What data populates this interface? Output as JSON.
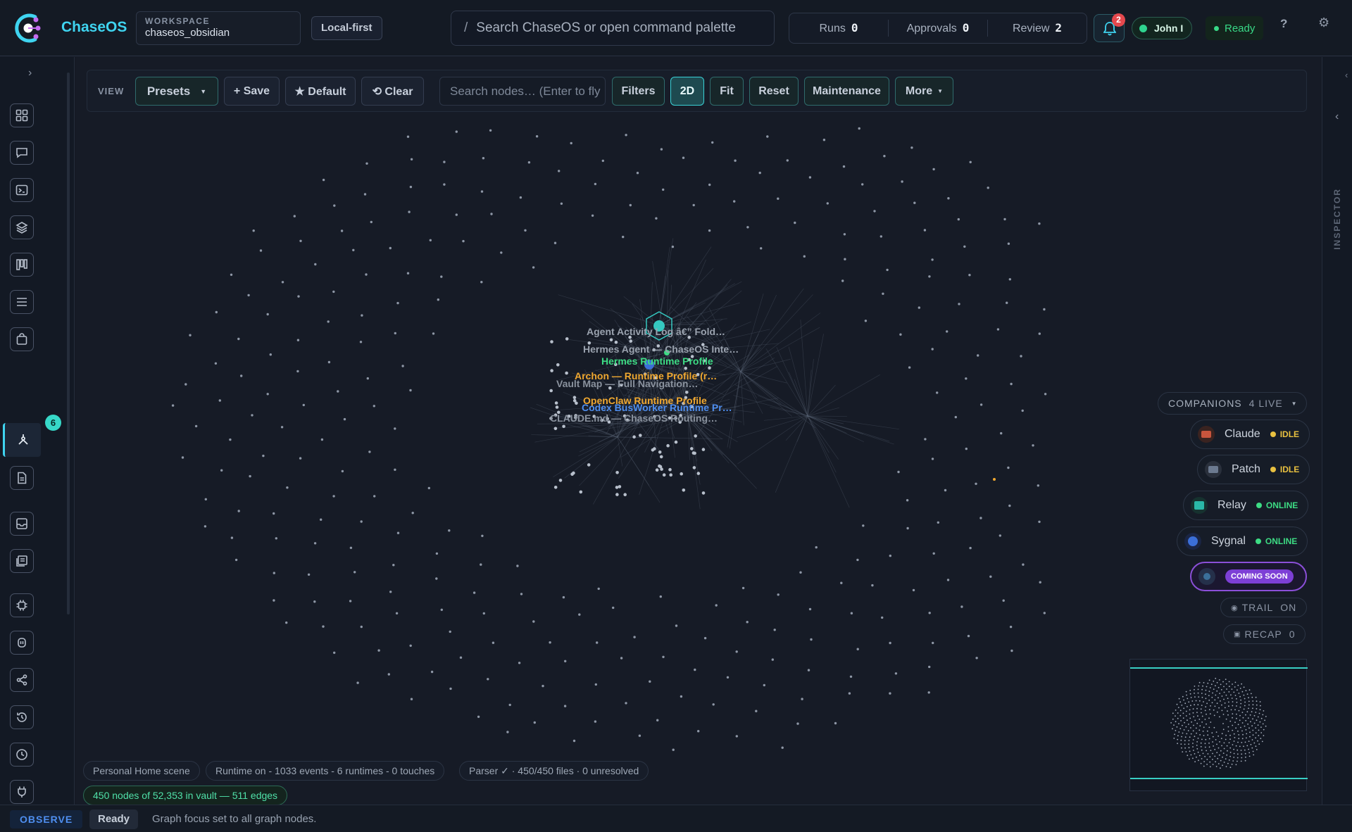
{
  "app": {
    "name": "ChaseOS"
  },
  "workspace": {
    "label": "WORKSPACE",
    "value": "chaseos_obsidian"
  },
  "mode_pill": "Local-first",
  "search": {
    "slash": "/",
    "placeholder": "Search ChaseOS or open command palette"
  },
  "counters": [
    {
      "label": "Runs",
      "value": "0"
    },
    {
      "label": "Approvals",
      "value": "0"
    },
    {
      "label": "Review",
      "value": "2"
    }
  ],
  "notifications": {
    "count": "2"
  },
  "user": {
    "name": "John I"
  },
  "status_top": "Ready",
  "help": "?",
  "sidebar": {
    "items": [
      "grid-icon",
      "chat-icon",
      "terminal-icon",
      "layers-icon",
      "board-icon",
      "list-icon",
      "bag-icon",
      "graph-icon",
      "document-icon",
      "inbox-icon",
      "pages-icon",
      "chip-icon",
      "archive-icon",
      "share-icon",
      "history-icon",
      "clock-icon",
      "plug-icon",
      "bolt-icon"
    ],
    "active": "graph-icon",
    "document_badge": "6"
  },
  "toolbar": {
    "view_label": "VIEW",
    "presets": "Presets",
    "save": "+ Save",
    "default": "★ Default",
    "clear": "⟲ Clear",
    "node_search_placeholder": "Search nodes… (Enter to fly",
    "filters": "Filters",
    "mode_2d": "2D",
    "fit": "Fit",
    "reset": "Reset",
    "maintenance": "Maintenance",
    "more": "More"
  },
  "graph_labels": [
    {
      "text": "Agent Activity Log â€” Fold…",
      "color": "#9aa2ae"
    },
    {
      "text": "Hermes Agent — ChaseOS Inte…",
      "color": "#9aa2ae"
    },
    {
      "text": "Hermes Runtime Profile",
      "color": "#3ddc84"
    },
    {
      "text": "Archon — Runtime Profile (r…",
      "color": "#f0a830"
    },
    {
      "text": "Vault Map — Full Navigation…",
      "color": "#8a929e"
    },
    {
      "text": "OpenClaw Runtime Profile",
      "color": "#f0a830"
    },
    {
      "text": "Codex BusWorker Runtime Pr…",
      "color": "#4f8ff0"
    },
    {
      "text": "CLAUDE.md — ChaseOS Routing…",
      "color": "#8a929e"
    }
  ],
  "companions": {
    "title": "COMPANIONS",
    "live": "4 LIVE",
    "items": [
      {
        "name": "Claude",
        "status": "IDLE",
        "status_color": "#e8c040",
        "avatar_color": "#c8553d"
      },
      {
        "name": "Patch",
        "status": "IDLE",
        "status_color": "#e8c040",
        "avatar_color": "#6c7a90"
      },
      {
        "name": "Relay",
        "status": "ONLINE",
        "status_color": "#3ddc84",
        "avatar_color": "#2ab8a8"
      },
      {
        "name": "Sygnal",
        "status": "ONLINE",
        "status_color": "#3ddc84",
        "avatar_color": "#3b6fd8"
      }
    ],
    "coming_soon": "COMING SOON",
    "trail": {
      "label": "TRAIL",
      "value": "ON"
    },
    "recap": {
      "label": "RECAP",
      "value": "0"
    }
  },
  "chips": {
    "scene": "Personal Home scene",
    "runtime": "Runtime on - 1033 events - 6 runtimes - 0 touches",
    "parser": "Parser ✓ · 450/450 files · 0 unresolved",
    "nodes": "450 nodes of 52,353 in vault — 511 edges"
  },
  "inspector": {
    "label": "INSPECTOR"
  },
  "statusbar": {
    "mode": "OBSERVE",
    "state": "Ready",
    "message": "Graph focus set to all graph nodes."
  }
}
